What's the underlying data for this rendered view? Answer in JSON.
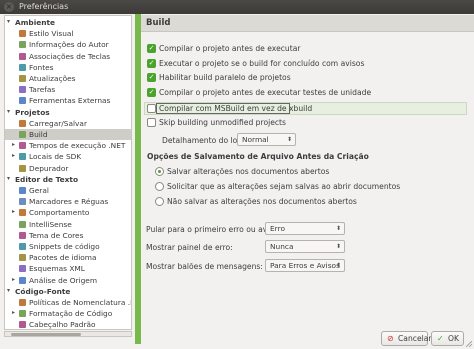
{
  "window": {
    "title": "Preferências"
  },
  "sidebar": {
    "items": [
      {
        "label": "Ambiente",
        "kind": "category",
        "icon": "collapse-arrow-icon"
      },
      {
        "label": "Estilo Visual",
        "kind": "item",
        "icon": "visual-style-icon"
      },
      {
        "label": "Informações do Autor",
        "kind": "item",
        "icon": "author-info-icon"
      },
      {
        "label": "Associações de Teclas",
        "kind": "item",
        "icon": "key-bindings-icon"
      },
      {
        "label": "Fontes",
        "kind": "item",
        "icon": "fonts-icon"
      },
      {
        "label": "Atualizações",
        "kind": "item",
        "icon": "updates-icon"
      },
      {
        "label": "Tarefas",
        "kind": "item",
        "icon": "tasks-icon"
      },
      {
        "label": "Ferramentas Externas",
        "kind": "item",
        "icon": "external-tools-icon"
      },
      {
        "label": "Projetos",
        "kind": "category",
        "icon": "collapse-arrow-icon"
      },
      {
        "label": "Carregar/Salvar",
        "kind": "item",
        "icon": "load-save-icon"
      },
      {
        "label": "Build",
        "kind": "item",
        "icon": "build-icon",
        "selected": true
      },
      {
        "label": "Tempos de execução .NET",
        "kind": "expandable",
        "icon": "runtimes-icon"
      },
      {
        "label": "Locais de SDK",
        "kind": "expandable",
        "icon": "sdk-locations-icon"
      },
      {
        "label": "Depurador",
        "kind": "item",
        "icon": "debugger-icon"
      },
      {
        "label": "Editor de Texto",
        "kind": "category",
        "icon": "collapse-arrow-icon"
      },
      {
        "label": "Geral",
        "kind": "item",
        "icon": "general-icon"
      },
      {
        "label": "Marcadores e Réguas",
        "kind": "item",
        "icon": "markers-rulers-icon"
      },
      {
        "label": "Comportamento",
        "kind": "expandable",
        "icon": "behavior-icon"
      },
      {
        "label": "IntelliSense",
        "kind": "item",
        "icon": "intellisense-icon"
      },
      {
        "label": "Tema de Cores",
        "kind": "item",
        "icon": "color-theme-icon"
      },
      {
        "label": "Snippets de código",
        "kind": "item",
        "icon": "code-snippets-icon"
      },
      {
        "label": "Pacotes de idioma",
        "kind": "item",
        "icon": "language-bundles-icon"
      },
      {
        "label": "Esquemas XML",
        "kind": "item",
        "icon": "xml-schemas-icon"
      },
      {
        "label": "Análise de Origem",
        "kind": "expandable",
        "icon": "source-analysis-icon"
      },
      {
        "label": "Código-Fonte",
        "kind": "category",
        "icon": "collapse-arrow-icon"
      },
      {
        "label": "Políticas de Nomenclatura .NET",
        "kind": "item",
        "icon": "naming-policies-icon"
      },
      {
        "label": "Formatação de Código",
        "kind": "expandable",
        "icon": "code-formatting-icon"
      },
      {
        "label": "Cabeçalho Padrão",
        "kind": "item",
        "icon": "standard-header-icon"
      }
    ]
  },
  "panel": {
    "title": "Build",
    "options": [
      {
        "label": "Compilar o projeto antes de executar",
        "checked": true
      },
      {
        "label": "Executar o projeto se o build for concluído com avisos",
        "checked": true
      },
      {
        "label": "Habilitar build paralelo de projetos",
        "checked": true
      },
      {
        "label": "Compilar o projeto antes de executar testes de unidade",
        "checked": true
      },
      {
        "label": "Compilar com MSBuild em vez de xbuild",
        "checked": false
      },
      {
        "label": "Skip building unmodified projects",
        "checked": false
      }
    ],
    "log_detail_label": "Detalhamento do log:",
    "log_detail_value": "Normal",
    "save_section_title": "Opções de Salvamento de Arquivo Antes da Criação",
    "save_options": [
      {
        "label": "Salvar alterações nos documentos abertos",
        "selected": true
      },
      {
        "label": "Solicitar que as alterações sejam salvas ao abrir documentos",
        "selected": false
      },
      {
        "label": "Não salvar as alterações nos documentos abertos",
        "selected": false
      }
    ],
    "jump_label": "Pular para o primeiro erro ou aviso:",
    "jump_value": "Erro",
    "show_error_label": "Mostrar painel de erro:",
    "show_error_value": "Nunca",
    "show_balloons_label": "Mostrar balões de mensagens:",
    "show_balloons_value": "Para Erros e Avisos"
  },
  "buttons": {
    "cancel": "Cancelar",
    "ok": "OK"
  },
  "colors": {
    "accent": "#77b94a",
    "check": "#4aa32c",
    "titlebar": "#3c3b37"
  }
}
